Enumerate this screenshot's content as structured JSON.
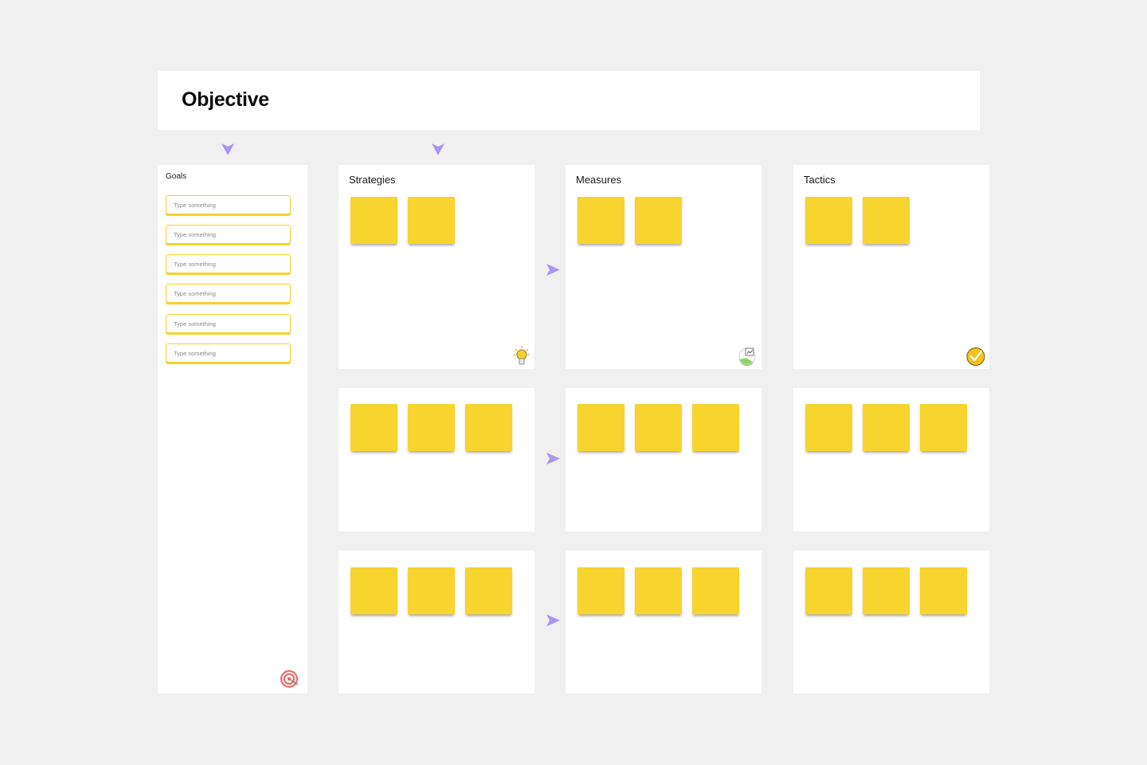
{
  "objective": {
    "title": "Objective"
  },
  "goals": {
    "label": "Goals",
    "fields": [
      {
        "placeholder": "Type something"
      },
      {
        "placeholder": "Type something"
      },
      {
        "placeholder": "Type something"
      },
      {
        "placeholder": "Type something"
      },
      {
        "placeholder": "Type something"
      },
      {
        "placeholder": "Type something"
      }
    ],
    "icon": "target-icon"
  },
  "columns": {
    "strategies": {
      "title": "Strategies",
      "icon": "lightbulb-icon"
    },
    "measures": {
      "title": "Measures",
      "icon": "chart-icon"
    },
    "tactics": {
      "title": "Tactics",
      "icon": "checkmark-icon"
    }
  },
  "colors": {
    "background": "#f0f0f0",
    "panel": "#ffffff",
    "sticky_note": "#f7d42e",
    "arrow": "#a994f0",
    "goal_field_border": "#f5d22c"
  }
}
